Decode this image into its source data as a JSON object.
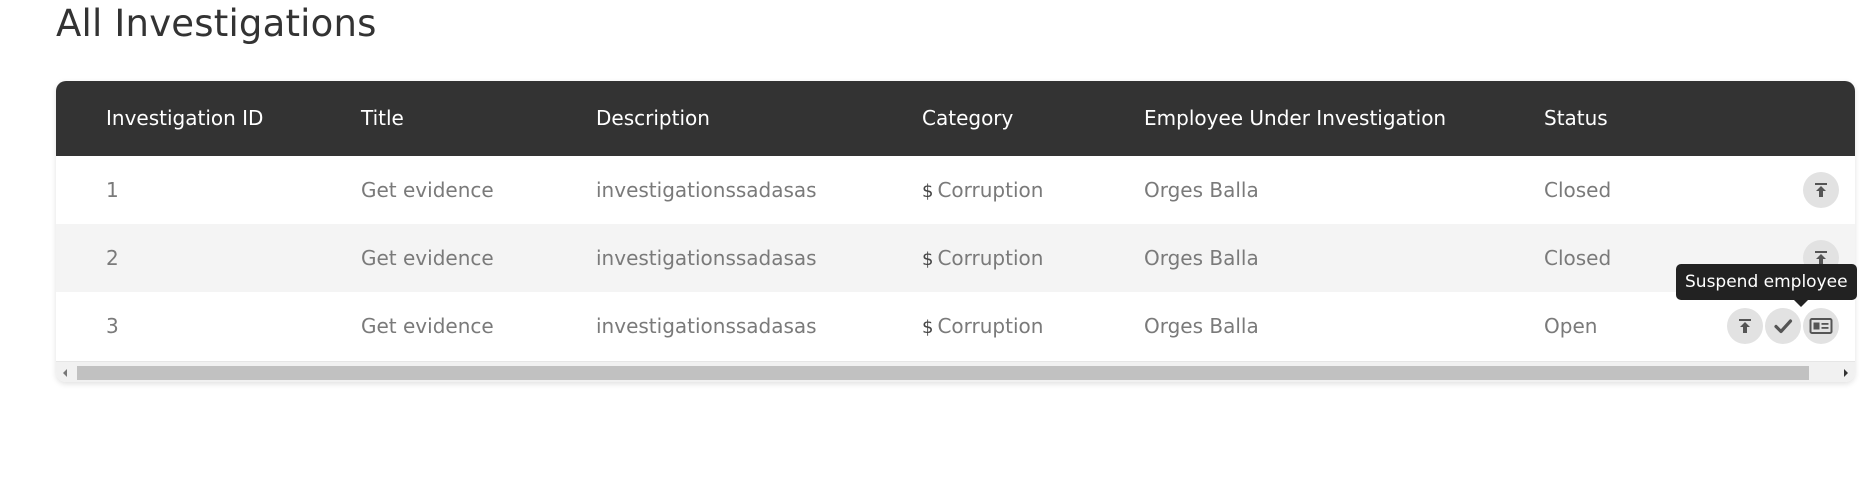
{
  "page": {
    "title": "All Investigations"
  },
  "table": {
    "columns": [
      "Investigation ID",
      "Title",
      "Description",
      "Category",
      "Employee Under Investigation",
      "Status"
    ],
    "category_icon_glyph": "$",
    "rows": [
      {
        "id": "1",
        "title": "Get evidence",
        "description": "investigationssadasas",
        "category": "Corruption",
        "employee": "Orges Balla",
        "status": "Closed",
        "actions": [
          "upload-icon"
        ]
      },
      {
        "id": "2",
        "title": "Get evidence",
        "description": "investigationssadasas",
        "category": "Corruption",
        "employee": "Orges Balla",
        "status": "Closed",
        "actions": [
          "upload-icon"
        ]
      },
      {
        "id": "3",
        "title": "Get evidence",
        "description": "investigationssadasas",
        "category": "Corruption",
        "employee": "Orges Balla",
        "status": "Open",
        "actions": [
          "upload-icon",
          "check-icon",
          "id-card-icon"
        ]
      }
    ]
  },
  "tooltip": {
    "text": "Suspend employee"
  },
  "colors": {
    "header_bg": "#333333",
    "row_alt_bg": "#f4f4f4",
    "cell_text": "#7a7a7a",
    "action_bg": "#e2e2e2",
    "icon": "#555555",
    "tooltip_bg": "#222222"
  }
}
